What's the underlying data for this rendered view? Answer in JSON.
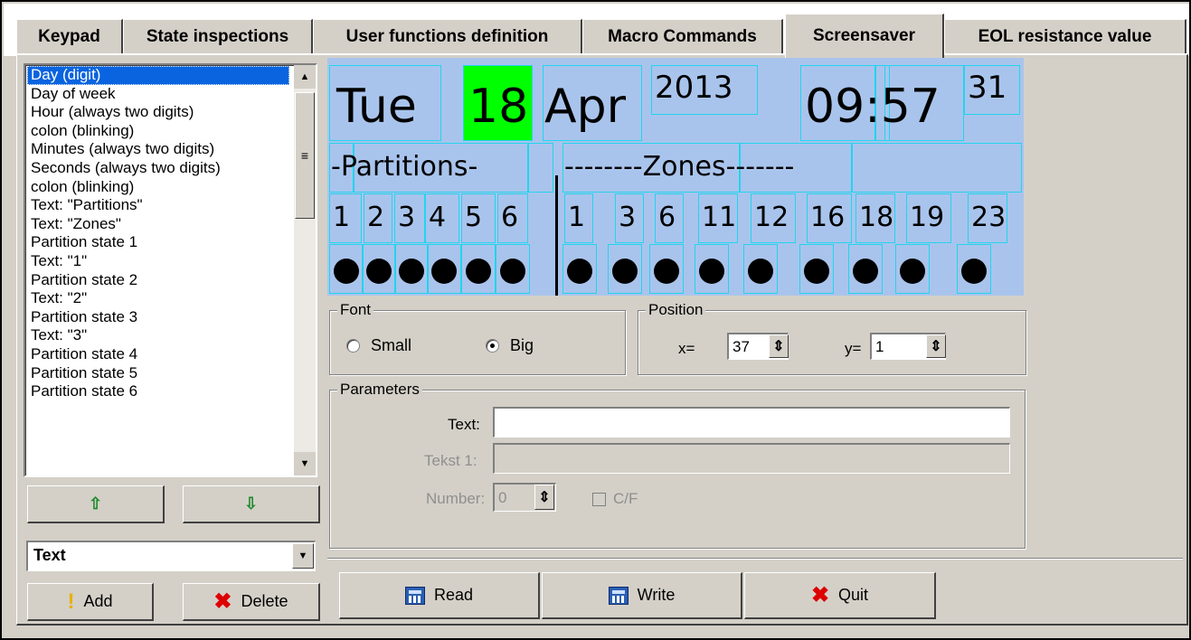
{
  "tabs": [
    {
      "label": "Keypad"
    },
    {
      "label": "State inspections"
    },
    {
      "label": "User functions definition"
    },
    {
      "label": "Macro Commands"
    },
    {
      "label": "Screensaver"
    },
    {
      "label": "EOL resistance value"
    }
  ],
  "active_tab": "Screensaver",
  "element_list": {
    "items": [
      "Day (digit)",
      "Day of week",
      "Hour (always two digits)",
      "colon (blinking)",
      "Minutes (always two digits)",
      "Seconds (always two digits)",
      "colon (blinking)",
      "Text: \"Partitions\"",
      "Text: \"Zones\"",
      "Partition state 1",
      "Text: \"1\"",
      "Partition state 2",
      "Text: \"2\"",
      "Partition state 3",
      "Text: \"3\"",
      "Partition state 4",
      "Partition state 5",
      "Partition state 6"
    ],
    "selected": "Day (digit)"
  },
  "element_type": {
    "value": "Text"
  },
  "buttons": {
    "add": "Add",
    "delete": "Delete",
    "read": "Read",
    "write": "Write",
    "quit": "Quit"
  },
  "preview": {
    "day_of_week": "Tue",
    "day": "18",
    "month": "Apr",
    "year": "2013",
    "time": "09:57",
    "seconds": "31",
    "partitions_line": "-Partitions-",
    "zones_line": "--------Zones-------",
    "partition_numbers": [
      "1",
      "2",
      "3",
      "4",
      "5",
      "6"
    ],
    "zone_numbers": [
      "1",
      "3",
      "6",
      "11",
      "12",
      "16",
      "18",
      "19",
      "23"
    ],
    "highlight_color": "#00ff00",
    "background_color": "#a9c4ec",
    "cell_border_color": "#22d4ee"
  },
  "font_group": {
    "title": "Font",
    "small_label": "Small",
    "big_label": "Big",
    "selected": "Big"
  },
  "position_group": {
    "title": "Position",
    "x_label": "x=",
    "x_value": "37",
    "y_label": "y=",
    "y_value": "1"
  },
  "parameters_group": {
    "title": "Parameters",
    "text_label": "Text:",
    "text_value": "",
    "tekst1_label": "Tekst 1:",
    "tekst1_value": "",
    "number_label": "Number:",
    "number_value": "0",
    "cf_label": "C/F",
    "cf_checked": false
  }
}
